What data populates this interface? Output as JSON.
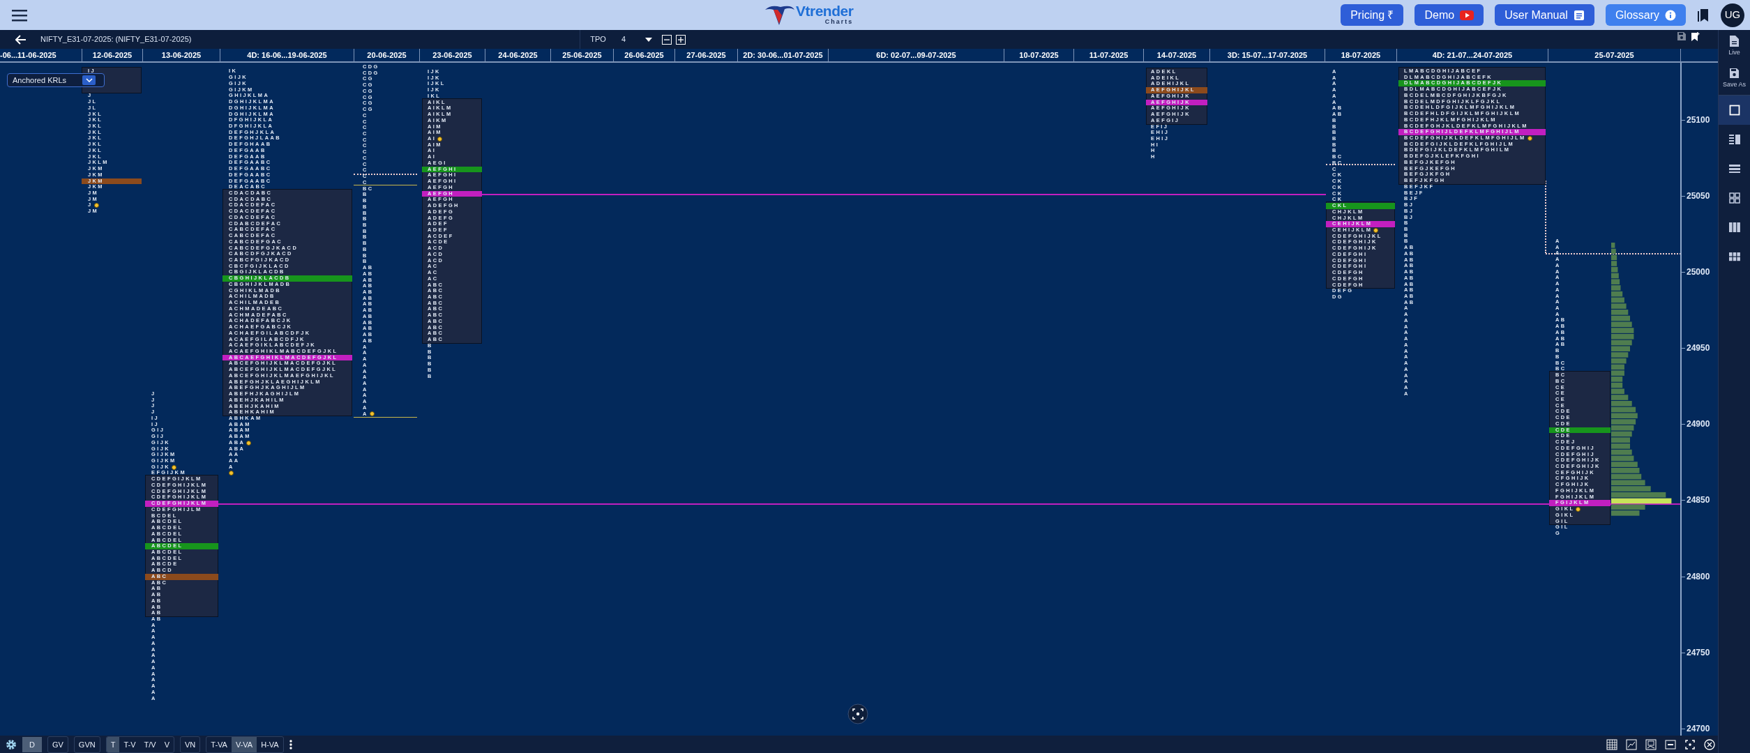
{
  "top_bar": {
    "brand": {
      "name": "Vtrender",
      "sub": "Charts"
    },
    "buttons": [
      {
        "label": "Pricing ₹",
        "kind": "plain"
      },
      {
        "label": "Demo",
        "kind": "video"
      },
      {
        "label": "User Manual",
        "kind": "doc"
      },
      {
        "label": "Glossary",
        "kind": "info"
      }
    ],
    "avatar": "UG"
  },
  "toolbar": {
    "title": "NIFTY_E31-07-2025: (NIFTY_E31-07-2025)",
    "tpo_label": "TPO",
    "tpo_value": "4"
  },
  "krl_dropdown": "Anchored KRLs",
  "dates": [
    "-06...11-06-2025",
    "12-06-2025",
    "13-06-2025",
    "4D: 16-06...19-06-2025",
    "20-06-2025",
    "23-06-2025",
    "24-06-2025",
    "25-06-2025",
    "26-06-2025",
    "27-06-2025",
    "2D: 30-06...01-07-2025",
    "6D: 02-07...09-07-2025",
    "10-07-2025",
    "11-07-2025",
    "14-07-2025",
    "3D: 15-07...17-07-2025",
    "18-07-2025",
    "4D: 21-07...24-07-2025",
    "25-07-2025"
  ],
  "profiles": [
    {
      "value_area": [
        "IJ"
      ],
      "below": [
        "J",
        "JL",
        "JL",
        "JKL",
        "JKL",
        "JKL",
        "JKL",
        "JKL",
        "JKL",
        "JKL",
        "JKL",
        "JKLM",
        "JKM",
        "JKM",
        {
          "text": "JKM",
          "kind": "ref"
        },
        "JKM",
        "JM",
        "JM",
        {
          "text": "J",
          "kind": "marker"
        },
        "JM"
      ]
    },
    {
      "above": [
        "J",
        "J",
        "J",
        "J",
        "IJ",
        "IJ",
        "GIJ",
        "GIJ",
        "GIJK",
        "GIJK",
        "GIJKM",
        "GIJKM",
        {
          "text": "GIJK",
          "kind": "marker"
        },
        "EFGIJKM"
      ],
      "value_area": [
        "CDEFGIJKLM",
        "CDEFGHIJKLM",
        "CDEFGHIJKLM",
        "CDEFGHIJKLM",
        {
          "text": "CDEFGHIJKLM",
          "kind": "poc"
        },
        "CDEFGHIJLM",
        "BCDEL",
        "ABCDEL",
        "ABCDEL",
        "ABCDEL",
        "ABCDEL",
        {
          "text": "ABCDEL",
          "kind": "vpoc"
        },
        "ABCDEL",
        "ABCDEL",
        "ABCDE",
        "ABCD",
        {
          "text": "ABC",
          "kind": "ref"
        },
        "ABC",
        "AB",
        "AB",
        "AB",
        "AB",
        "AB"
      ],
      "below": [
        "AB",
        "A",
        "A",
        "A",
        "A",
        "A",
        "A",
        "A",
        "A",
        "A",
        "A",
        "A",
        "A",
        "A"
      ]
    },
    {
      "above": [
        "IK",
        "GIJK",
        "GIJK",
        "GIJKM",
        "GHIJKLMA",
        "DGHIJKLMA",
        "DGHIJKLMA",
        "DGHIJKLMA",
        "DFGHIJKLA",
        "DFGHIJKLA",
        "DEFGHJKLA",
        "DEFGHJLAAB",
        "DEFGHAAB",
        "DEFGAAB",
        "DEFGAAB",
        "DEFGAABC",
        "DEFGAABC",
        "DEFGAABC",
        "DEFGAABC",
        "DEACABC"
      ],
      "value_area": [
        "CDACDABC",
        "CDACDABC",
        "CDACDEFAC",
        "CDACDEFAC",
        "CDACDEFAC",
        "CDABCDEFAC",
        "CABCDEFAC",
        "CABCDEFAC",
        "CABCDEFGAC",
        "CABCDEFGJKACD",
        "CABCDFGJKACD",
        "CABCFGIJKACD",
        "CBCFGIJKLACD",
        "CBGIJKLACDB",
        {
          "text": "CBGHIJKLACDB",
          "kind": "vpoc"
        },
        "CBGHIJKLMADB",
        "CGHIKLMADB",
        "ACHILMADB",
        "ACHILMADEB",
        "ACHMADEABC",
        "ACHMADEFABC",
        "ACHADEFABCJK",
        "ACHAEFGABCJK",
        "ACHAEFGILABCDFJK",
        "ACAEFGILABCDFJK",
        "ACAEFGIKLABCDEFJK",
        "ACAEFGHIKLMABCDEFGJKL",
        {
          "text": "ABCAEFGHIKLMACDEFGJKL",
          "kind": "poc"
        },
        "ABCEFGHIJKLMACDEFGJKL",
        "ABCEFGHIJKLMACDEFGJKL",
        "ABCEFGHIJKLMAEFGHIJKL",
        "ABEFGHJKLAEGHIJKLM",
        "ABEFGHJKAGHIJLM",
        "ABEFHJKAGHIJLM",
        "ABEHJKAHILM",
        "ABEHJKAHIM",
        "ABEHKAHIM"
      ],
      "below": [
        "ABHKAM",
        "ABAM",
        "ABAM",
        "ABAM",
        {
          "text": "ABA",
          "kind": "marker"
        },
        "ABA",
        "AA",
        "AA",
        "A",
        {
          "kind": "dot"
        }
      ]
    },
    {
      "above": [
        "CDG",
        "CDG",
        "CG",
        "CG",
        "CG",
        "CG",
        "CG",
        "CG",
        "C",
        "C",
        "C",
        "C",
        "C",
        "C",
        "C",
        "C",
        "C",
        "C",
        "C",
        "C"
      ],
      "value_area": [
        "BC",
        "B",
        "B",
        "B",
        "B",
        "B",
        "B",
        "B",
        "B",
        "B",
        "B",
        "B",
        "B",
        "AB",
        "AB",
        "AB",
        "AB",
        "AB",
        "AB",
        "AB",
        "AB",
        "AB",
        "AB",
        "AB",
        "AB",
        "AB",
        "A",
        "A",
        "A",
        "A",
        "A",
        "A",
        "A",
        "A",
        "A",
        "A",
        "A",
        {
          "text": "A",
          "kind": "marker"
        }
      ]
    },
    {
      "above": [
        "IJK",
        "IJK",
        "IJKL",
        "IJK",
        "IKL"
      ],
      "value_area": [
        "AIKL",
        "AIKLM",
        "AIKLM",
        "AIKM",
        "AIM",
        "AIM",
        {
          "text": "AI",
          "kind": "marker"
        },
        "AIM",
        "AI",
        "AI",
        "AEGI",
        {
          "text": "AEFGHI",
          "kind": "vpoc"
        },
        "AEFGHI",
        "AEFGHI",
        "AEFGH",
        {
          "text": "AEFGH",
          "kind": "poc"
        },
        "AEFGH",
        "ADEFGH",
        "ADEFG",
        "ADEFG",
        "ADEF",
        "ADEF",
        "ACDEF",
        "ACDE",
        "ACD",
        "ACD",
        "ACD",
        "AC",
        "AC",
        "AC",
        "ABC",
        "ABC",
        "ABC",
        "ABC",
        "ABC",
        "ABC",
        "ABC",
        "ABC",
        "ABC",
        "ABC"
      ],
      "below": [
        "B",
        "B",
        "B",
        "B",
        "B",
        "B"
      ]
    },
    {
      "value_area": [
        "ADEKL",
        "ADEIKL",
        "ADEHIJKL",
        {
          "text": "AEFGHIJKL",
          "kind": "ref"
        },
        "AEFGHIJK",
        {
          "text": "AEFGHIJK",
          "kind": "poc"
        },
        "AEFGHIJK",
        "AEFGHIJK",
        "AEFGIJ"
      ],
      "below": [
        "EFIJ",
        "EHIJ",
        "EHIJ",
        "HI",
        "H",
        "H"
      ]
    },
    {
      "above": [
        "A",
        "A",
        "A",
        "A",
        "A",
        "A",
        "AB",
        "AB",
        "B",
        "B",
        "B",
        "B",
        "B",
        "B",
        "BC",
        "BC",
        "C",
        "CK",
        "CK",
        "CK",
        "CK",
        "CK"
      ],
      "value_area": [
        {
          "text": "CKL",
          "kind": "vpoc"
        },
        "CHJKLM",
        "CHJKLM",
        {
          "text": "CEHIJKLM",
          "kind": "poc"
        },
        {
          "text": "CEHIJKLM",
          "kind": "marker"
        },
        "CDEFGHIJKL",
        "CDEFGHIJK",
        "CDEFGHIJK",
        "CDEFGHI",
        "CDEFGHI",
        "CDEFGHI",
        "CDEFGH",
        "CDEFGH",
        "CDEFGH"
      ],
      "below": [
        "DEFG",
        "DG"
      ]
    },
    {
      "value_area": [
        "LMABCDGHIJABCEF",
        "DLMABCDGHIJABCEFK",
        {
          "text": "DLMABCDGHIJABCDEFJK",
          "kind": "vpoc"
        },
        "BDLMABCDGHIJABCEFJK",
        "BCDELMBCDFGHIJKBFGJK",
        "BCDELMDFGHIJKLFGJKL",
        "BCDEHLDFGIJKLMFGHIJKLM",
        "BCDEFHLDFGIJKLMFGHIJKLM",
        "BCDEFHJKLMFGHIJKLM",
        "BCDEFGHJKLDEFKLMFGHIJKLM",
        {
          "text": "BCDEFGHIJLDEFKLMFGHIJLM",
          "kind": "poc"
        },
        {
          "text": "BCDEFGHIJKLDEFKLMFGHIJLM",
          "kind": "marker"
        },
        "BCDEFGIJKLDEFKLFGHIJLM",
        "BDEFGIJKLDEFKLMFGHILM",
        "BDEFGJKLEFKFGHI",
        "BEFGJKEFGH",
        "BEFGJKEFGH",
        "BEFGJKFGH",
        "BEFJKFGH"
      ],
      "below": [
        "BEFJKF",
        "BEJF",
        "BJF",
        "BJ",
        "BJ",
        "BJ",
        "B",
        "B",
        "B",
        "B",
        "AB",
        "AB",
        "AB",
        "AB",
        "AB",
        "AB",
        "AB",
        "AB",
        "AB",
        "AB",
        "A",
        "A",
        "A",
        "A",
        "A",
        "A",
        "A",
        "A",
        "A",
        "A",
        "A",
        "A",
        "A",
        "A",
        "A"
      ]
    },
    {
      "above": [
        "A",
        "A",
        "A",
        "A",
        "A",
        "A",
        "A",
        "A",
        "A",
        "A",
        "A",
        "A",
        "A",
        "AB",
        "AB",
        "AB",
        "AB",
        "AB",
        "B",
        "B",
        "BC",
        "BC"
      ],
      "value_area": [
        "BC",
        "BC",
        "CE",
        "CE",
        "CE",
        "CE",
        "CDE",
        "CDE",
        "CDE",
        {
          "text": "CDE",
          "kind": "vpoc"
        },
        "CDE",
        "CDEJ",
        "CDEFGHIJ",
        "CDEFGHIJ",
        "CDEFGHIJK",
        "CDEFGHIJK",
        "CEFGHIJK",
        "CFGHIJK",
        "CFGHIJK",
        "FGHIJKLM",
        "FGHIJKLM",
        {
          "text": "FGIJKLM",
          "kind": "poc"
        },
        {
          "text": "GIKL",
          "kind": "marker"
        },
        "GIKL",
        "GIL"
      ],
      "below": [
        "GIL",
        "G"
      ]
    }
  ],
  "price_axis": [
    "25100",
    "25050",
    "25000",
    "24950",
    "24900",
    "24850",
    "24800",
    "24750",
    "24700"
  ],
  "sidebar": {
    "actions": [
      {
        "label": "Live",
        "kind": "doc"
      },
      {
        "label": "Save As",
        "kind": "save"
      }
    ],
    "layouts": [
      {
        "kind": "single",
        "selected": true
      },
      {
        "kind": "split",
        "selected": false
      },
      {
        "kind": "rows",
        "selected": false
      },
      {
        "kind": "grid",
        "selected": false
      },
      {
        "kind": "columns",
        "selected": false
      },
      {
        "kind": "grid6",
        "selected": false
      }
    ]
  },
  "bottom_toolbar": {
    "groups": [
      [
        {
          "label": "D",
          "selected": true
        }
      ],
      [
        {
          "label": "GV",
          "selected": false
        }
      ],
      [
        {
          "label": "GVN",
          "selected": false
        }
      ],
      [
        {
          "label": "T",
          "selected": true
        },
        {
          "label": "T-V",
          "selected": false
        },
        {
          "label": "T/V",
          "selected": false
        },
        {
          "label": "V",
          "selected": false
        }
      ],
      [
        {
          "label": "VN",
          "selected": false
        }
      ],
      [
        {
          "label": "T-VA",
          "selected": false
        },
        {
          "label": "V-VA",
          "selected": true
        },
        {
          "label": "H-VA",
          "selected": false
        }
      ]
    ]
  }
}
